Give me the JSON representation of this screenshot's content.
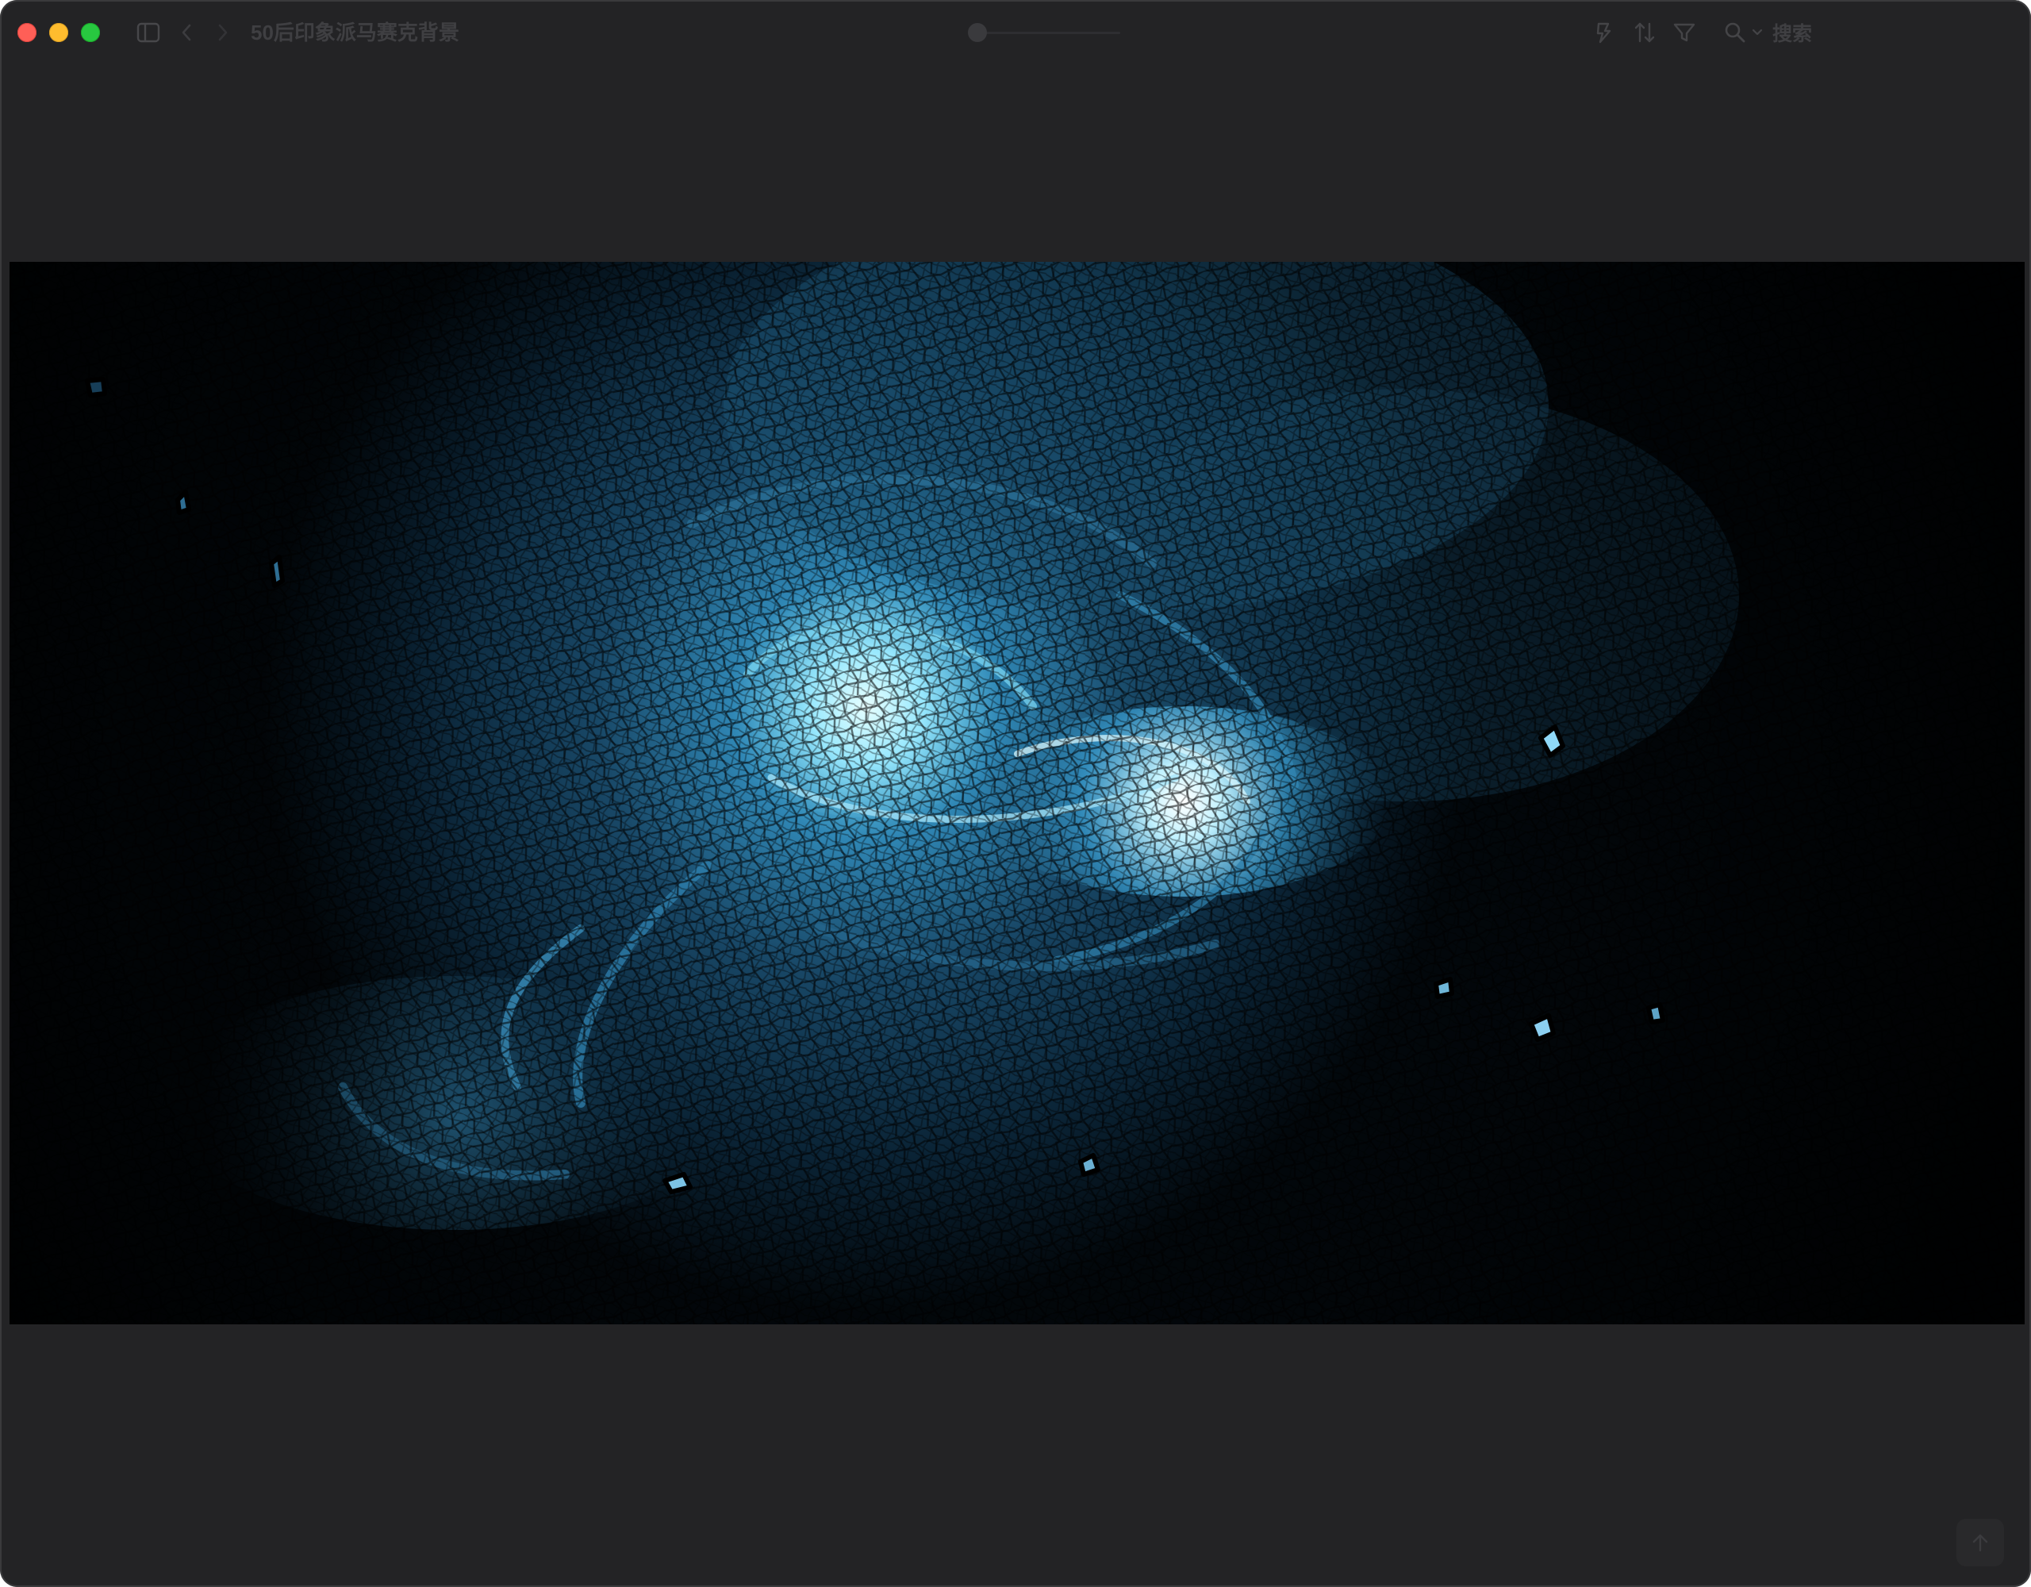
{
  "window": {
    "title": "50后印象派马赛克背景"
  },
  "toolbar": {
    "sidebar_toggle_icon": "sidebar-icon",
    "back_icon": "chevron-left-icon",
    "forward_icon": "chevron-right-icon",
    "magic_icon": "magic-wand-icon",
    "sort_icon": "sort-arrows-icon",
    "filter_icon": "filter-icon",
    "search_icon": "search-icon",
    "search_placeholder": "搜索"
  },
  "main": {
    "image_icon": "image-preview",
    "scroll_top_icon": "arrow-up-icon"
  },
  "colors": {
    "window_bg": "#232325",
    "image_deep": "#02070b",
    "image_mid": "#1e4e6e",
    "image_glow": "#bff4ff",
    "traffic_close": "#ff5f57",
    "traffic_min": "#febc2e",
    "traffic_max": "#28c840"
  }
}
